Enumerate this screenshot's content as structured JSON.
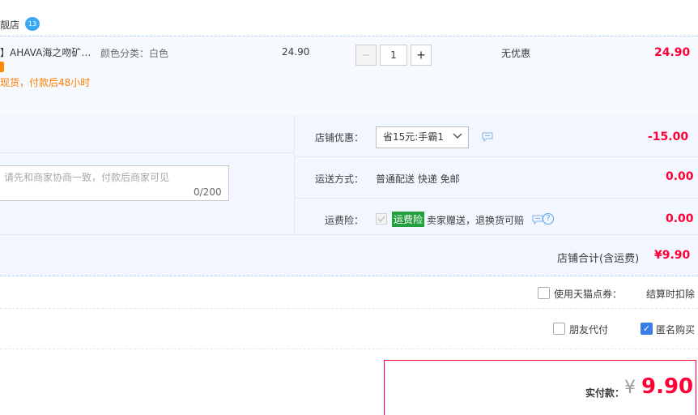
{
  "shop": {
    "name": "靓店",
    "wangwang_badge": "13"
  },
  "item": {
    "title": "】AHAVA海之吻矿…",
    "attribute": "颜色分类：白色",
    "delivery_note": "现货，付款后48小时",
    "unit_price": "24.90",
    "quantity": "1",
    "quantity_minus": "−",
    "quantity_plus": "+",
    "discount": "无优惠",
    "total": "24.90"
  },
  "memo": {
    "placeholder": "请先和商家协商一致，付款后商家可见",
    "count": "0/200"
  },
  "shop_promo": {
    "label": "店铺优惠：",
    "selected": "省15元:手霸1",
    "amount": "-15.00"
  },
  "shipping": {
    "label": "运送方式：",
    "value": "普通配送 快递 免邮",
    "amount": "0.00"
  },
  "insurance": {
    "label": "运费险：",
    "tag": "运费险",
    "text": "卖家赠送，退换货可赔",
    "help": "?",
    "amount": "0.00"
  },
  "shop_total": {
    "label": "店铺合计(含运费)",
    "amount": "¥9.90"
  },
  "tmall_coupon": {
    "label": "使用天猫点券：",
    "note": "结算时扣除"
  },
  "friend_pay": {
    "label": "朋友代付"
  },
  "anonymous": {
    "label": "匿名购买",
    "check": "✓"
  },
  "payment": {
    "label": "实付款：",
    "currency": "¥",
    "amount": "9.90"
  },
  "colors": {
    "price_red": "#ff0036",
    "accent_blue": "#3b7de6",
    "insurance_green": "#22a03d"
  }
}
